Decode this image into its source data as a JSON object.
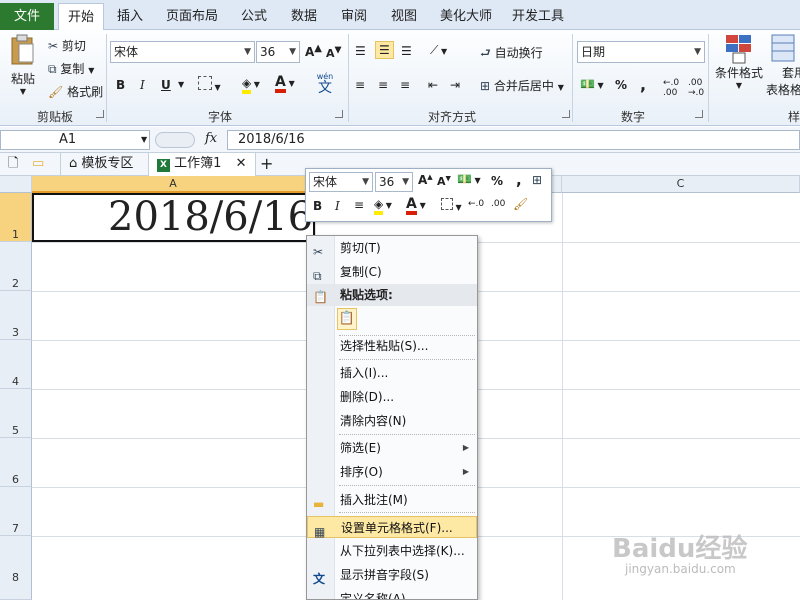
{
  "tabs": {
    "file": "文件",
    "items": [
      "开始",
      "插入",
      "页面布局",
      "公式",
      "数据",
      "审阅",
      "视图",
      "美化大师",
      "开发工具"
    ]
  },
  "ribbon": {
    "clipboard": {
      "paste": "粘贴",
      "cut": "剪切",
      "copy": "复制",
      "format_painter": "格式刷",
      "label": "剪贴板"
    },
    "font": {
      "name": "宋体",
      "size": "36",
      "label": "字体",
      "wen": "wén",
      "wen_char": "文"
    },
    "alignment": {
      "wrap": "自动换行",
      "merge": "合并后居中",
      "label": "对齐方式"
    },
    "number": {
      "format": "日期",
      "label": "数字",
      "percent": "%",
      "comma": ","
    },
    "styles": {
      "conditional": "条件格式",
      "table1": "套用",
      "table2": "表格格",
      "label": "样"
    }
  },
  "formula_bar": {
    "name_box": "A1",
    "fx": "fx",
    "content": "2018/6/16"
  },
  "workbook_tabs": {
    "template": "模板专区",
    "book": "工作簿1",
    "add": "+"
  },
  "grid": {
    "columns": [
      "A",
      "C"
    ],
    "rows": [
      "1",
      "2",
      "3",
      "4",
      "5",
      "6",
      "7",
      "8"
    ],
    "a1_value": "2018/6/16"
  },
  "mini_toolbar": {
    "font": "宋体",
    "size": "36",
    "percent": "%",
    "comma": ","
  },
  "context_menu": {
    "cut": "剪切(T)",
    "copy": "复制(C)",
    "paste_options": "粘贴选项:",
    "paste_special": "选择性粘贴(S)...",
    "insert": "插入(I)...",
    "delete": "删除(D)...",
    "clear": "清除内容(N)",
    "filter": "筛选(E)",
    "sort": "排序(O)",
    "comment": "插入批注(M)",
    "format_cells": "设置单元格格式(F)...",
    "pick_list": "从下拉列表中选择(K)...",
    "phonetic": "显示拼音字段(S)",
    "define_name": "定义名称(A)..."
  },
  "watermark": {
    "brand": "Baidu经验",
    "url": "jingyan.baidu.com"
  },
  "colors": {
    "file_tab": "#2b7a2f",
    "highlight": "#fde9a4",
    "font_red": "#d81e06",
    "fill_yellow": "#ffeb00"
  }
}
